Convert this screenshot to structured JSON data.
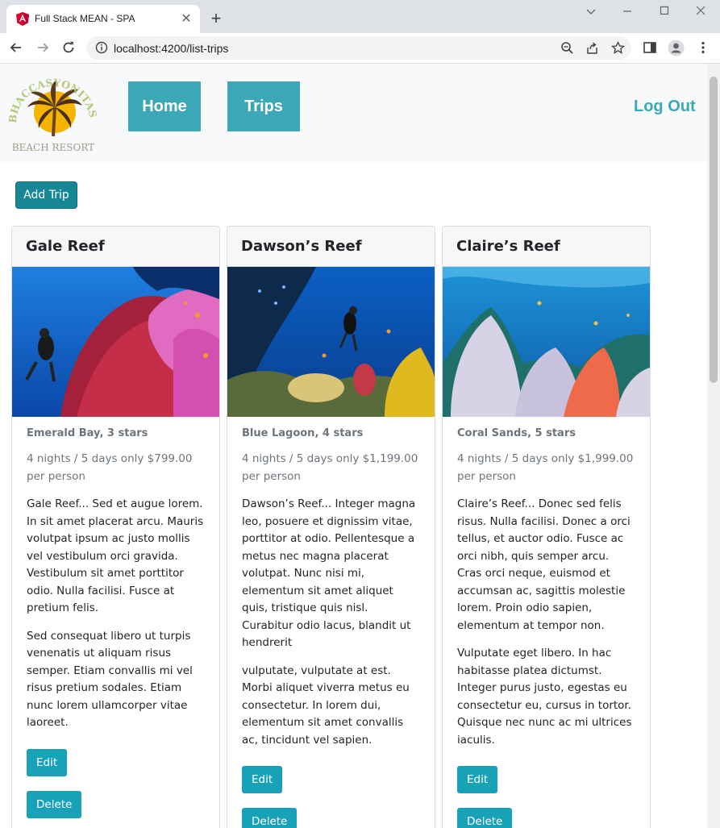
{
  "browser": {
    "tab_title": "Full Stack MEAN - SPA",
    "new_tab_symbol": "+",
    "close_tab_symbol": "✕",
    "url": "localhost:4200/list-trips"
  },
  "header": {
    "logo_alt": "Bhaccasyonitas Beach Resort",
    "logo_top_text": "BHACCASYONITAS",
    "logo_bottom_text": "BEACH RESORT",
    "nav": [
      {
        "label": "Home"
      },
      {
        "label": "Trips"
      }
    ],
    "logout_label": "Log Out"
  },
  "actions": {
    "add_trip_label": "Add Trip"
  },
  "colors": {
    "accent": "#3ba8b8",
    "primary_button": "#178795",
    "info_button": "#17a2b8"
  },
  "trips": [
    {
      "name": "Gale Reef",
      "resort": "Emerald Bay, 3 stars",
      "price": "4 nights / 5 days only $799.00 per person",
      "paragraphs": [
        "Gale Reef... Sed et augue lorem. In sit amet placerat arcu. Mauris volutpat ipsum ac justo mollis vel vestibulum orci gravida. Vestibulum sit amet porttitor odio. Nulla facilisi. Fusce at pretium felis.",
        "Sed consequat libero ut turpis venenatis ut aliquam risus semper. Etiam convallis mi vel risus pretium sodales. Etiam nunc lorem ullamcorper vitae laoreet."
      ],
      "edit_label": "Edit",
      "delete_label": "Delete"
    },
    {
      "name": "Dawson’s Reef",
      "resort": "Blue Lagoon, 4 stars",
      "price": "4 nights / 5 days only $1,199.00 per person",
      "paragraphs": [
        "Dawson’s Reef... Integer magna leo, posuere et dignissim vitae, porttitor at odio. Pellentesque a metus nec magna placerat volutpat. Nunc nisi mi, elementum sit amet aliquet quis, tristique quis nisl. Curabitur odio lacus, blandit ut hendrerit",
        "vulputate, vulputate at est. Morbi aliquet viverra metus eu consectetur. In lorem dui, elementum sit amet convallis ac, tincidunt vel sapien."
      ],
      "edit_label": "Edit",
      "delete_label": "Delete"
    },
    {
      "name": "Claire’s Reef",
      "resort": "Coral Sands, 5 stars",
      "price": "4 nights / 5 days only $1,999.00 per person",
      "paragraphs": [
        "Claire’s Reef... Donec sed felis risus. Nulla facilisi. Donec a orci tellus, et auctor odio. Fusce ac orci nibh, quis semper arcu. Cras orci neque, euismod et accumsan ac, sagittis molestie lorem. Proin odio sapien, elementum at tempor non.",
        "Vulputate eget libero. In hac habitasse platea dictumst. Integer purus justo, egestas eu consectetur eu, cursus in tortor. Quisque nec nunc ac mi ultrices iaculis."
      ],
      "edit_label": "Edit",
      "delete_label": "Delete"
    }
  ]
}
